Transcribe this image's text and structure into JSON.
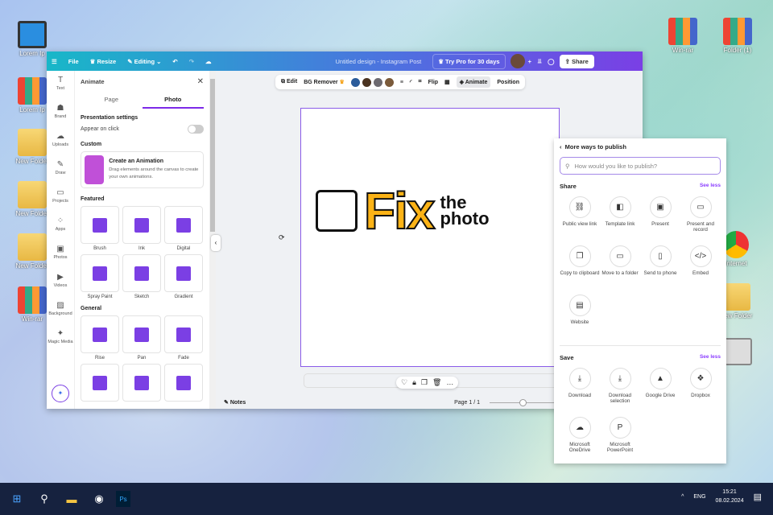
{
  "desktop": {
    "left": [
      "Lorem Ip",
      "Lorem Ip",
      "New Folder",
      "New Folder",
      "New Folder",
      "Win-rar"
    ],
    "right": [
      "Win-rar",
      "Folder (1)",
      "Internet",
      "New Folder",
      ""
    ]
  },
  "header": {
    "file": "File",
    "resize": "Resize",
    "editing": "Editing",
    "title": "Untitled design - Instagram Post",
    "try_pro": "Try Pro for 30 days",
    "share": "Share"
  },
  "rail": [
    {
      "label": "Text",
      "icon": "T"
    },
    {
      "label": "Brand",
      "icon": "☗"
    },
    {
      "label": "Uploads",
      "icon": "☁"
    },
    {
      "label": "Draw",
      "icon": "✎"
    },
    {
      "label": "Projects",
      "icon": "▭"
    },
    {
      "label": "Apps",
      "icon": "⁘"
    },
    {
      "label": "Photos",
      "icon": "▣"
    },
    {
      "label": "Videos",
      "icon": "▶"
    },
    {
      "label": "Background",
      "icon": "▨"
    },
    {
      "label": "Magic Media",
      "icon": "✦"
    }
  ],
  "panel": {
    "title": "Animate",
    "tabs": [
      "Page",
      "Photo"
    ],
    "presentation": "Presentation settings",
    "appear_on_click": "Appear on click",
    "custom": "Custom",
    "create_title": "Create an Animation",
    "create_desc": "Drag elements around the canvas to create your own animations.",
    "featured": "Featured",
    "featured_items": [
      "Brush",
      "Ink",
      "Digital",
      "Spray Paint",
      "Sketch",
      "Gradient"
    ],
    "general": "General",
    "general_items": [
      "Rise",
      "Pan",
      "Fade",
      "",
      "",
      ""
    ]
  },
  "toolbar": {
    "edit": "Edit",
    "bg_remover": "BG Remover",
    "colors": [
      "#2a5b9a",
      "#4a3320",
      "#6d6a70",
      "#7a5a3a"
    ],
    "flip": "Flip",
    "animate": "Animate",
    "position": "Position"
  },
  "logo": {
    "fix": "Fix",
    "the": "the",
    "photo": "photo"
  },
  "footer": {
    "notes": "Notes",
    "page": "Page 1 / 1",
    "zoom_fraction": 0.45
  },
  "publish": {
    "title": "More ways to publish",
    "search_placeholder": "How would you like to publish?",
    "share": "Share",
    "see_less": "See less",
    "share_items": [
      {
        "label": "Public view link",
        "icon": "⛓"
      },
      {
        "label": "Template link",
        "icon": "◧"
      },
      {
        "label": "Present",
        "icon": "▣"
      },
      {
        "label": "Present and record",
        "icon": "▭"
      },
      {
        "label": "Copy to clipboard",
        "icon": "❐"
      },
      {
        "label": "Move to a folder",
        "icon": "▭"
      },
      {
        "label": "Send to phone",
        "icon": "▯"
      },
      {
        "label": "Embed",
        "icon": "</>"
      },
      {
        "label": "Website",
        "icon": "▤"
      }
    ],
    "save": "Save",
    "save_items": [
      {
        "label": "Download",
        "icon": "⤓"
      },
      {
        "label": "Download selection",
        "icon": "⤓"
      },
      {
        "label": "Google Drive",
        "icon": "▲"
      },
      {
        "label": "Dropbox",
        "icon": "❖"
      },
      {
        "label": "Microsoft OneDrive",
        "icon": "☁"
      },
      {
        "label": "Microsoft PowerPoint",
        "icon": "P"
      }
    ]
  },
  "taskbar": {
    "lang": "ENG",
    "time": "15:21",
    "date": "08.02.2024"
  }
}
